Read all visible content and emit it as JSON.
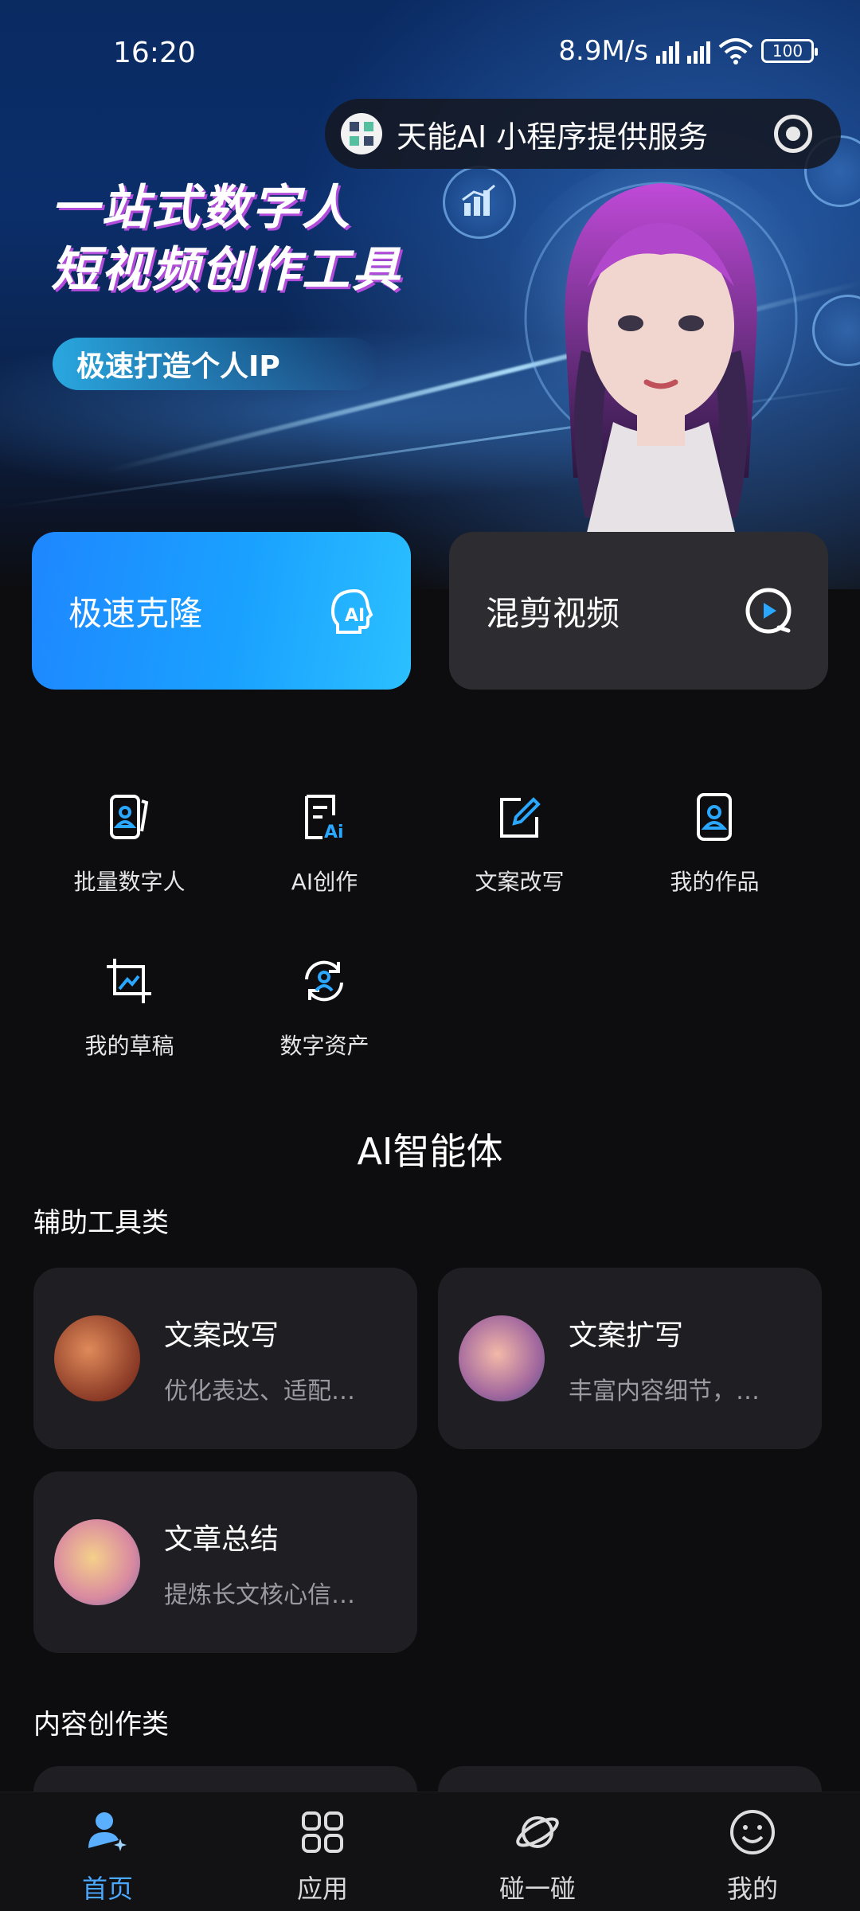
{
  "status_bar": {
    "time": "16:20",
    "speed": "8.9M/s",
    "battery": "100"
  },
  "mini_program": {
    "name": "天能AI 小程序提供服务"
  },
  "hero": {
    "title_line1": "一站式数字人",
    "title_line2": "短视频创作工具",
    "subtitle": "极速打造个人IP"
  },
  "actions": [
    {
      "label": "极速克隆",
      "icon": "ai-head-icon"
    },
    {
      "label": "混剪视频",
      "icon": "play-circle-icon"
    }
  ],
  "grid": [
    {
      "label": "批量数字人",
      "icon": "digital-human-batch-icon"
    },
    {
      "label": "AI创作",
      "icon": "ai-document-icon"
    },
    {
      "label": "文案改写",
      "icon": "edit-icon"
    },
    {
      "label": "我的作品",
      "icon": "works-icon"
    },
    {
      "label": "我的草稿",
      "icon": "crop-icon"
    },
    {
      "label": "数字资产",
      "icon": "asset-sync-icon"
    }
  ],
  "section": {
    "title": "AI智能体",
    "group1": "辅助工具类",
    "group2": "内容创作类"
  },
  "agents": [
    {
      "title": "文案改写",
      "desc": "优化表达、适配…"
    },
    {
      "title": "文案扩写",
      "desc": "丰富内容细节，…"
    },
    {
      "title": "文章总结",
      "desc": "提炼长文核心信…"
    }
  ],
  "tabs": [
    {
      "label": "首页",
      "active": true
    },
    {
      "label": "应用",
      "active": false
    },
    {
      "label": "碰一碰",
      "active": false
    },
    {
      "label": "我的",
      "active": false
    }
  ],
  "colors": {
    "accent": "#4aa8ff",
    "clone_card": "#1e87ff",
    "card_bg": "#1f1f23"
  }
}
